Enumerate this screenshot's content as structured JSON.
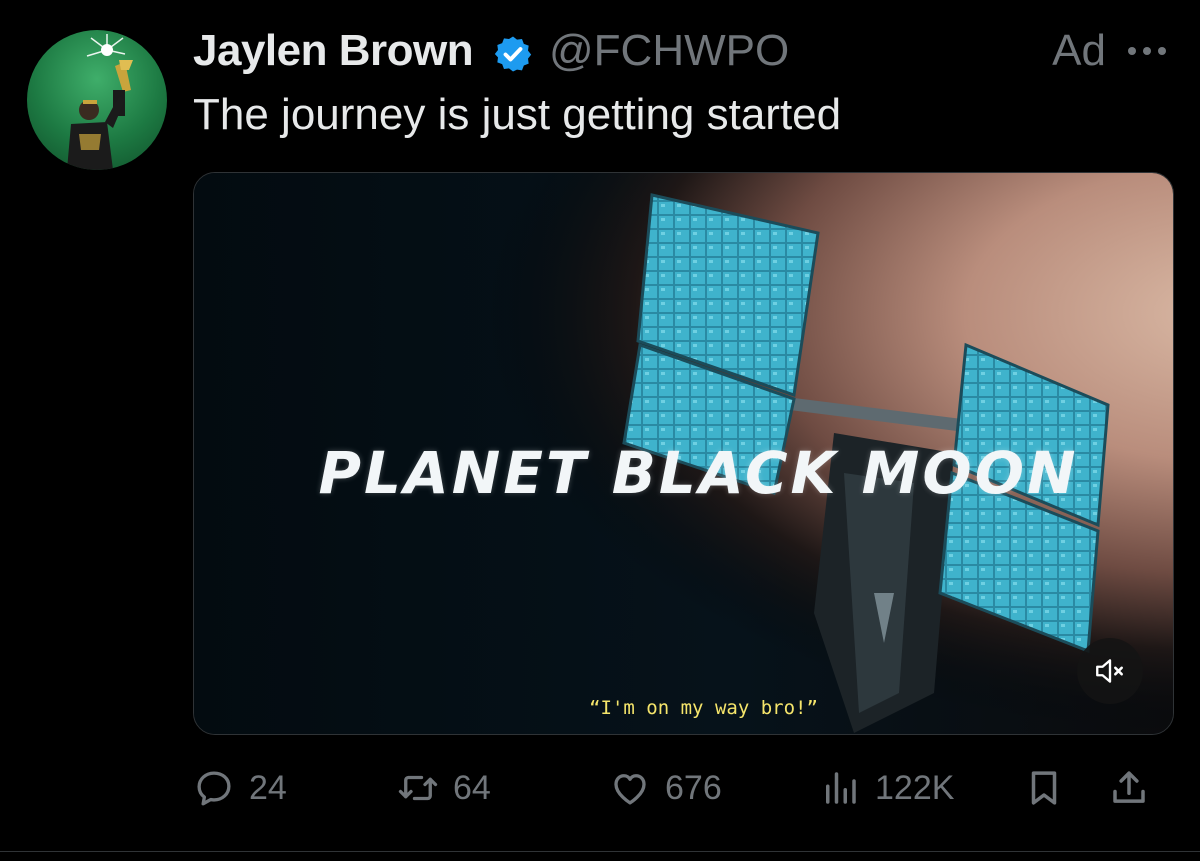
{
  "tweet": {
    "author_name": "Jaylen Brown",
    "handle": "@FCHWPO",
    "ad_label": "Ad",
    "text": "The journey is just getting started"
  },
  "media": {
    "title": "PLANET BLACK MOON",
    "caption": "“I'm on my way bro!”"
  },
  "actions": {
    "replies": "24",
    "reposts": "64",
    "likes": "676",
    "views": "122K"
  },
  "icons": {
    "verified": "verified-badge-icon",
    "more": "more-icon",
    "mute": "mute-icon",
    "reply": "reply-icon",
    "repost": "repost-icon",
    "like": "heart-icon",
    "views": "views-icon",
    "bookmark": "bookmark-icon",
    "share": "share-icon"
  },
  "colors": {
    "background": "#000000",
    "text_primary": "#e7e9ea",
    "text_secondary": "#71767b",
    "verified_blue": "#1d9bf0",
    "caption_yellow": "#f5e56b"
  }
}
